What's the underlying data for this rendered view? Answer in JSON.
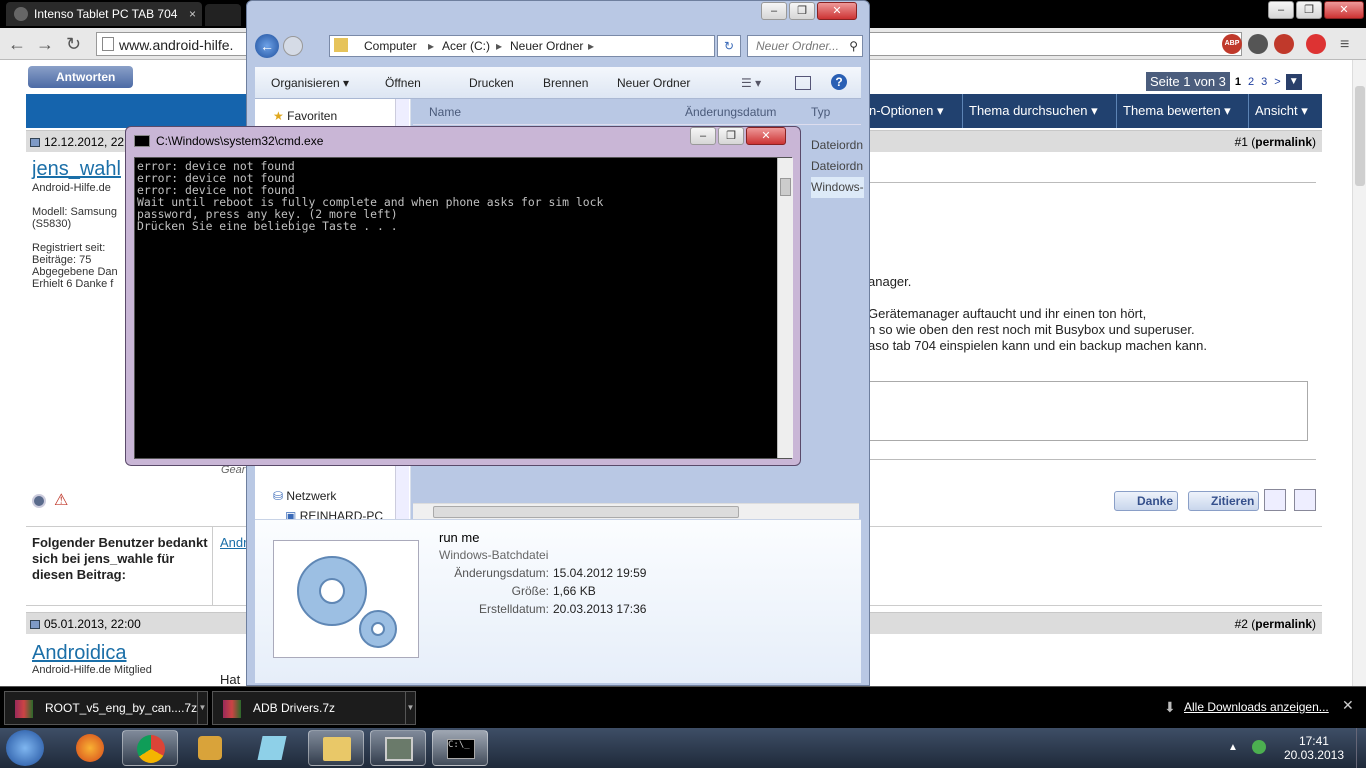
{
  "browser": {
    "tab_title": "Intenso Tablet PC TAB 704",
    "url": "www.android-hilfe.",
    "extension_badge": "ABP"
  },
  "forum": {
    "reply_button": "Antworten",
    "pagination": {
      "label": "Seite 1 von 3",
      "pages": [
        "1",
        "2",
        "3"
      ],
      "next": ">"
    },
    "menu": [
      "n-Optionen",
      "Thema durchsuchen",
      "Thema bewerten",
      "Ansicht"
    ],
    "post1": {
      "date": "12.12.2012, 22",
      "number": "#1",
      "permalink": "permalink",
      "username": "jens_wahl",
      "user_title": "Android-Hilfe.de",
      "info": [
        "Modell: Samsung",
        "(S5830)",
        "",
        "Registriert seit: ",
        "Beiträge: 75",
        "Abgegebene Dan",
        "Erhielt 6 Danke f"
      ],
      "partial_lines": [
        "anager.",
        "Gerätemanager auftaucht und ihr einen ton hört,",
        "n so wie oben den rest noch mit Busybox und superuser.",
        "aso tab 704 einspielen kann und ein backup machen kann."
      ],
      "gear_fragment": "Gear",
      "thanks_button": "Danke",
      "quote_button": "Zitieren"
    },
    "thanks_box": {
      "text": "Folgender Benutzer bedankt sich bei jens_wahle für diesen Beitrag:",
      "link": "Andr"
    },
    "post2": {
      "date": "05.01.2013, 22:00",
      "number": "#2",
      "permalink": "permalink",
      "username": "Androidica",
      "user_title": "Android-Hilfe.de Mitglied",
      "text_fragment": "Hat"
    }
  },
  "explorer": {
    "breadcrumb": [
      "Computer",
      "Acer (C:)",
      "Neuer Ordner"
    ],
    "search_placeholder": "Neuer Ordner...",
    "toolbar": [
      "Organisieren",
      "Öffnen",
      "Drucken",
      "Brennen",
      "Neuer Ordner"
    ],
    "nav": {
      "favorites": "Favoriten",
      "network": "Netzwerk",
      "pc": "REINHARD-PC"
    },
    "columns": [
      "Name",
      "Änderungsdatum",
      "Typ"
    ],
    "type_values": [
      "Dateiordn",
      "Dateiordn",
      "Windows-"
    ],
    "details": {
      "name": "run me",
      "type": "Windows-Batchdatei",
      "modified_label": "Änderungsdatum:",
      "modified_value": "15.04.2012 19:59",
      "size_label": "Größe:",
      "size_value": "1,66 KB",
      "created_label": "Erstelldatum:",
      "created_value": "20.03.2013 17:36"
    }
  },
  "cmd": {
    "title": "C:\\Windows\\system32\\cmd.exe",
    "output": "error: device not found\nerror: device not found\nerror: device not found\nWait until reboot is fully complete and when phone asks for sim lock\npassword, press any key. (2 more left)\nDrücken Sie eine beliebige Taste . . ."
  },
  "downloads": {
    "items": [
      "ROOT_v5_eng_by_can....7z",
      "ADB Drivers.7z"
    ],
    "show_all": "Alle Downloads anzeigen..."
  },
  "taskbar": {
    "time": "17:41",
    "date": "20.03.2013"
  },
  "colors": {
    "accent_blue": "#1564ad",
    "cmd_background": "#000000",
    "taskbar": "#2a3648"
  }
}
